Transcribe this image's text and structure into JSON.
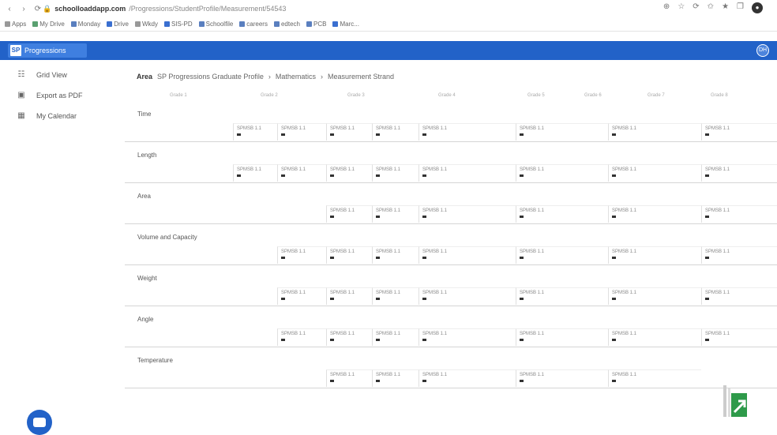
{
  "browser": {
    "nav": [
      "‹",
      "›",
      "⟳"
    ],
    "url_host": "schoolloaddapp.com",
    "url_path": "/Progressions/StudentProfile/Measurement/54543",
    "tool_icons": [
      "⊕",
      "☆",
      "⟳",
      "✩",
      "★",
      "❐"
    ],
    "avatar": "●"
  },
  "bookmarks": [
    "Apps",
    "My Drive",
    "Monday",
    "Drive",
    "Wkdy",
    "SIS-PD",
    "Schoolfile",
    "careers",
    "edtech",
    "PCB",
    "Marc..."
  ],
  "app": {
    "brand": "Progressions",
    "logo": "SP",
    "user_initials": "DH"
  },
  "sidebar": {
    "items": [
      {
        "label": "Grid View",
        "icon": "☷"
      },
      {
        "label": "Export as PDF",
        "icon": "▣"
      },
      {
        "label": "My Calendar",
        "icon": "▦"
      }
    ]
  },
  "breadcrumb": {
    "label": "Area",
    "parts": [
      "SP Progressions Graduate Profile",
      "›",
      "Mathematics",
      "›",
      "Measurement Strand"
    ]
  },
  "column_headers": [
    "Grade 1",
    "Grade 2",
    "Grade 3",
    "Grade 4",
    "Grade 5",
    "Grade 6",
    "Grade 7",
    "Grade 8"
  ],
  "rows": [
    {
      "label": "Time"
    },
    {
      "label": "Length"
    },
    {
      "label": "Area"
    },
    {
      "label": "Volume and Capacity"
    },
    {
      "label": "Weight"
    },
    {
      "label": "Angle"
    },
    {
      "label": "Temperature"
    }
  ],
  "cell_text": "SPMSB 1.1",
  "colors": {
    "appbar": "#2262c8",
    "accent": "#3f7fe0"
  }
}
